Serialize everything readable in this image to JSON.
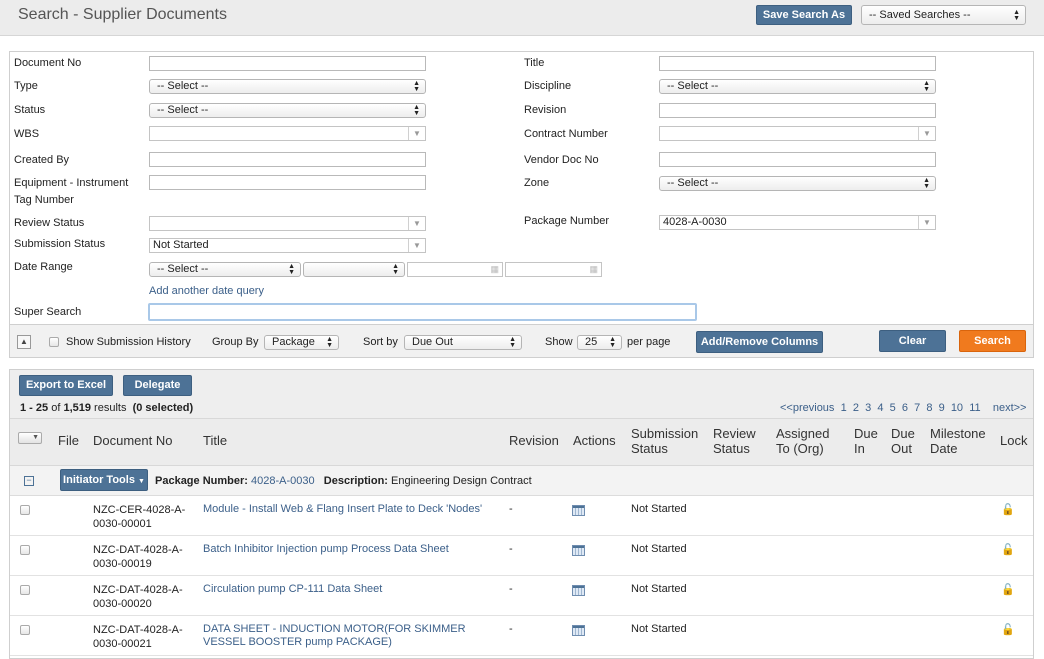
{
  "header": {
    "title": "Search - Supplier Documents",
    "save_search_label": "Save Search As",
    "saved_searches_value": "-- Saved Searches --"
  },
  "form": {
    "document_no": {
      "label": "Document No",
      "value": ""
    },
    "type": {
      "label": "Type",
      "value": "-- Select --"
    },
    "status": {
      "label": "Status",
      "value": "-- Select --"
    },
    "wbs": {
      "label": "WBS",
      "value": ""
    },
    "created_by": {
      "label": "Created By",
      "value": ""
    },
    "equipment_tag": {
      "label_line1": "Equipment - Instrument",
      "label_line2": "Tag Number",
      "value": ""
    },
    "review_status": {
      "label": "Review Status",
      "value": ""
    },
    "submission_status": {
      "label": "Submission Status",
      "value": "Not Started"
    },
    "date_range": {
      "label": "Date Range",
      "value": "-- Select --",
      "add_query_link": "Add another date query"
    },
    "super_search": {
      "label": "Super Search",
      "value": ""
    },
    "title": {
      "label": "Title",
      "value": ""
    },
    "discipline": {
      "label": "Discipline",
      "value": "-- Select --"
    },
    "revision": {
      "label": "Revision",
      "value": ""
    },
    "contract_number": {
      "label": "Contract Number",
      "value": ""
    },
    "vendor_doc_no": {
      "label": "Vendor Doc No",
      "value": ""
    },
    "zone": {
      "label": "Zone",
      "value": "-- Select --"
    },
    "package_number": {
      "label": "Package Number",
      "value": "4028-A-0030"
    }
  },
  "toolbar": {
    "show_history_label": "Show Submission History",
    "group_by_label": "Group By",
    "group_by_value": "Package",
    "sort_by_label": "Sort by",
    "sort_by_value": "Due Out",
    "show_label": "Show",
    "show_value": "25",
    "per_page_label": "per page",
    "columns_button": "Add/Remove Columns",
    "clear_button": "Clear",
    "search_button": "Search"
  },
  "results": {
    "export_button": "Export to Excel",
    "delegate_button": "Delegate",
    "range": "1 - 25",
    "of_text": "of",
    "total": "1,519",
    "results_text": "results",
    "selected": "(0 selected)",
    "pagination": {
      "previous": "<<previous",
      "pages": [
        "1",
        "2",
        "3",
        "4",
        "5",
        "6",
        "7",
        "8",
        "9",
        "10",
        "11"
      ],
      "next": "next>>"
    },
    "columns": {
      "file": "File",
      "document_no": "Document No",
      "title": "Title",
      "revision": "Revision",
      "actions": "Actions",
      "submission_status_1": "Submission",
      "submission_status_2": "Status",
      "review_status_1": "Review",
      "review_status_2": "Status",
      "assigned_1": "Assigned",
      "assigned_2": "To (Org)",
      "due_in_1": "Due",
      "due_in_2": "In",
      "due_out_1": "Due",
      "due_out_2": "Out",
      "milestone_1": "Milestone",
      "milestone_2": "Date",
      "lock": "Lock"
    },
    "group": {
      "initiator_tools": "Initiator Tools",
      "package_label": "Package Number:",
      "package_value": "4028-A-0030",
      "description_label": "Description:",
      "description_value": "Engineering Design Contract"
    },
    "rows": [
      {
        "doc_line1": "NZC-CER-4028-A-",
        "doc_line2": "0030-00001",
        "title_line1": "Module - Install Web & Flang Insert Plate to Deck 'Nodes'",
        "title_line2": "",
        "revision": "-",
        "submission_status": "Not Started"
      },
      {
        "doc_line1": "NZC-DAT-4028-A-",
        "doc_line2": "0030-00019",
        "title_line1": "Batch Inhibitor Injection pump Process Data Sheet",
        "title_line2": "",
        "revision": "-",
        "submission_status": "Not Started"
      },
      {
        "doc_line1": "NZC-DAT-4028-A-",
        "doc_line2": "0030-00020",
        "title_line1": "Circulation pump CP-111 Data Sheet",
        "title_line2": "",
        "revision": "-",
        "submission_status": "Not Started"
      },
      {
        "doc_line1": "NZC-DAT-4028-A-",
        "doc_line2": "0030-00021",
        "title_line1": "DATA SHEET - INDUCTION MOTOR(FOR SKIMMER",
        "title_line2": "VESSEL BOOSTER pump PACKAGE)",
        "revision": "-",
        "submission_status": "Not Started"
      }
    ]
  }
}
